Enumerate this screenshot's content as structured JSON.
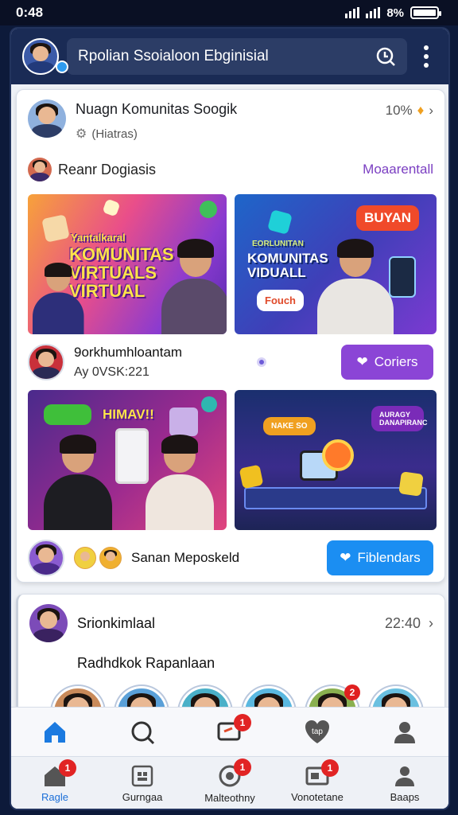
{
  "status_bar": {
    "time": "0:48",
    "battery": "8%"
  },
  "top_bar": {
    "search_text": "Rpolian Ssoialoon Ebginisial"
  },
  "post1": {
    "group_name": "Nuagn Komunitas Soogik",
    "group_sub": "(Hiatras)",
    "percent": "10%",
    "author_name": "Reanr Dogiasis",
    "more_link": "Moaarentall",
    "tile1_caption_top": "Yantalkaral",
    "tile1_caption_main": "KOMUNITAS VIRTUALS VIRTUAL",
    "tile2_caption_top": "EORLUNITAN",
    "tile2_caption_main": "KOMUNITAS VIDUALL",
    "tile2_bubble": "BUYAN",
    "tile2_tag": "Fouch",
    "tile3_caption": "HIMAV!!",
    "author2_name": "9orkhumhloantam",
    "author2_sub": "Ay 0VSK:221",
    "button_purple": "Coriers",
    "tile4_bubble1": "NAKE SO",
    "tile4_bubble2": "AURAGY DANAPIRANC",
    "author3_name": "Sanan Meposkeld",
    "button_blue": "Fiblendars"
  },
  "post2": {
    "title": "Srionkimlaal",
    "time": "22:40",
    "subtitle": "Radhdkok Rapanlaan",
    "story_badges": {
      "5": "2"
    }
  },
  "nav_row1": [
    {
      "icon": "home-icon",
      "label": ""
    },
    {
      "icon": "search-chat-icon",
      "label": ""
    },
    {
      "icon": "messages-icon",
      "label": "",
      "badge": "1"
    },
    {
      "icon": "heart-shield-icon",
      "label": ""
    },
    {
      "icon": "profile-icon",
      "label": ""
    }
  ],
  "nav_row2": [
    {
      "label": "Ragle",
      "badge": "1"
    },
    {
      "label": "Gurngaa"
    },
    {
      "label": "Malteothny",
      "badge": "1"
    },
    {
      "label": "Vonotetane",
      "badge": "1"
    },
    {
      "label": "Baaps"
    }
  ],
  "colors": {
    "accent_blue": "#1b8ef2",
    "accent_purple": "#8b45d6",
    "header": "#1a2b55",
    "badge": "#e12424"
  }
}
